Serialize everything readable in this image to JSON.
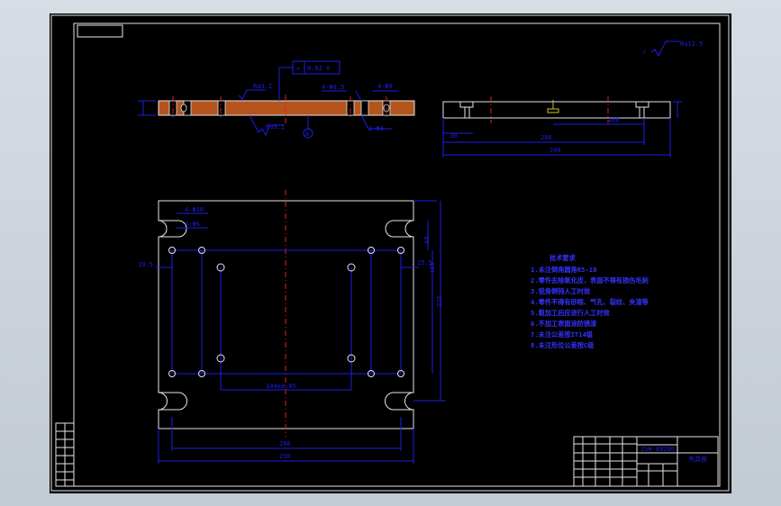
{
  "colors": {
    "background": "#000000",
    "outline": "#e6e6e6",
    "dimension": "#1e1ee8",
    "centerline": "#e02020",
    "section_hatch": "#b5541c",
    "hole_axis": "#d4c020"
  },
  "top_view": {
    "callout_holes_a": "4-Φ10",
    "callout_holes_b": "4-Φ6",
    "dim_left": "19.5",
    "dim_right": "25.5",
    "dim_right_small": "40",
    "dim_right_mid": "165",
    "dim_height": "225",
    "dim_inner": "144±0.05",
    "dim_width_inner": "200",
    "dim_width": "230"
  },
  "section_view": {
    "roughness_top": "Ra3.2",
    "roughness_bottom": "Ra3.2",
    "flatness": "0.02 A",
    "callout_center": "4-Φ8.5",
    "callout_right": "4-Φ8",
    "callout_small": "2-Φ6",
    "datum": "A"
  },
  "side_view": {
    "dim_a": "30",
    "dim_b": "206",
    "dim_c": "180",
    "dim_total": "240"
  },
  "corner": {
    "roughness": "Ra12.5"
  },
  "technical_notes": {
    "title": "技术要求",
    "items": [
      "1.未注倒角圆角R5-10",
      "2.零件去除氧化皮，表面不得有损伤毛刺",
      "3.锐角倒钝人工时效",
      "4.零件不得有砂眼、气孔、裂纹、夹渣等",
      "5.粗加工后应进行人工时效",
      "6.不加工表面涂防锈漆",
      "7.未注公差按IT14级",
      "8.未注形位公差按C级"
    ]
  },
  "title_block": {
    "drawing_no": "JSH-80200",
    "part_name": "夹具座"
  }
}
